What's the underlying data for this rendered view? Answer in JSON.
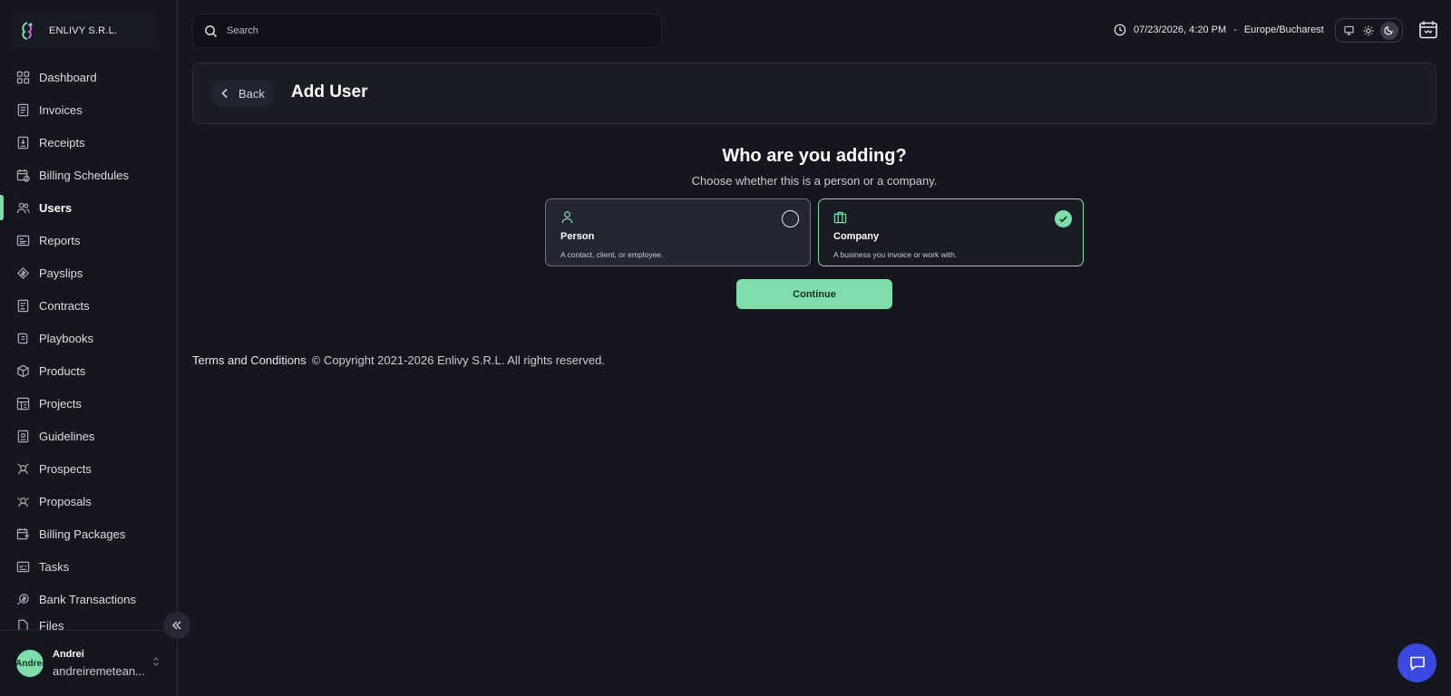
{
  "brand": {
    "name": "ENLIVY S.R.L."
  },
  "sidebar": {
    "items": [
      {
        "label": "Dashboard",
        "icon": "dashboard-icon"
      },
      {
        "label": "Invoices",
        "icon": "invoice-icon"
      },
      {
        "label": "Receipts",
        "icon": "receipt-icon"
      },
      {
        "label": "Billing Schedules",
        "icon": "billing-schedule-icon"
      },
      {
        "label": "Users",
        "icon": "users-icon",
        "active": true
      },
      {
        "label": "Reports",
        "icon": "reports-icon"
      },
      {
        "label": "Payslips",
        "icon": "payslips-icon"
      },
      {
        "label": "Contracts",
        "icon": "contracts-icon"
      },
      {
        "label": "Playbooks",
        "icon": "playbooks-icon"
      },
      {
        "label": "Products",
        "icon": "products-icon"
      },
      {
        "label": "Projects",
        "icon": "projects-icon"
      },
      {
        "label": "Guidelines",
        "icon": "guidelines-icon"
      },
      {
        "label": "Prospects",
        "icon": "prospects-icon"
      },
      {
        "label": "Proposals",
        "icon": "proposals-icon"
      },
      {
        "label": "Billing Packages",
        "icon": "billing-packages-icon"
      },
      {
        "label": "Tasks",
        "icon": "tasks-icon"
      },
      {
        "label": "Bank Transactions",
        "icon": "bank-transactions-icon"
      },
      {
        "label": "Files",
        "icon": "files-icon"
      }
    ]
  },
  "user": {
    "name": "Andrei",
    "email": "andreiremetean...",
    "avatar_text": "Andrei"
  },
  "search": {
    "placeholder": "Search"
  },
  "clock": {
    "datetime": "07/23/2026, 4:20 PM",
    "separator": "-",
    "timezone": "Europe/Bucharest"
  },
  "header": {
    "back_label": "Back",
    "title": "Add User"
  },
  "main": {
    "question": "Who are you adding?",
    "subtitle": "Choose whether this is a person or a company.",
    "options": [
      {
        "title": "Person",
        "description": "A contact, client, or employee.",
        "selected": false
      },
      {
        "title": "Company",
        "description": "A business you invoice or work with.",
        "selected": true
      }
    ],
    "continue_label": "Continue"
  },
  "footer": {
    "terms": "Terms and Conditions",
    "copyright": "© Copyright 2021-2026 Enlivy S.R.L. All rights reserved."
  },
  "colors": {
    "accent": "#7fdcab",
    "background": "#15161f",
    "chat": "#3b49df"
  }
}
